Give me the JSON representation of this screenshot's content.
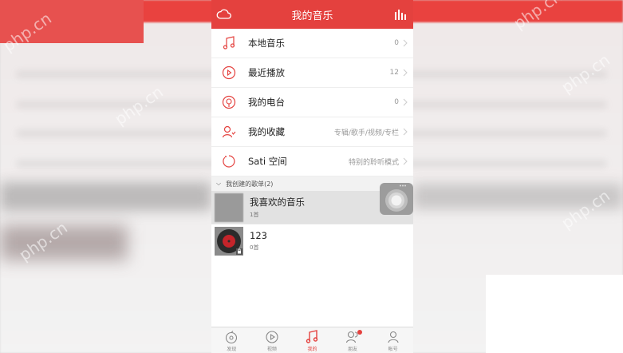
{
  "header": {
    "title": "我的音乐"
  },
  "menu": [
    {
      "label": "本地音乐",
      "right": "0",
      "icon": "music-note-icon"
    },
    {
      "label": "最近播放",
      "right": "12",
      "icon": "recent-play-icon"
    },
    {
      "label": "我的电台",
      "right": "0",
      "icon": "radio-icon"
    },
    {
      "label": "我的收藏",
      "right": "专辑/歌手/视频/专栏",
      "icon": "favorite-user-icon"
    },
    {
      "label": "Sati 空间",
      "right": "特别的聆听模式",
      "icon": "sati-icon"
    }
  ],
  "section": {
    "title": "我创建的歌单(2)"
  },
  "playlists": [
    {
      "name": "我喜欢的音乐",
      "count": "1首"
    },
    {
      "name": "123",
      "count": "0首"
    }
  ],
  "tabs": [
    {
      "label": "发现",
      "icon": "discover-icon"
    },
    {
      "label": "视频",
      "icon": "video-icon"
    },
    {
      "label": "我的",
      "icon": "my-music-icon"
    },
    {
      "label": "朋友",
      "icon": "friends-icon"
    },
    {
      "label": "帐号",
      "icon": "account-icon"
    }
  ],
  "watermark": "php.cn",
  "colors": {
    "accent": "#e4413e",
    "tab_active": "#e4413e"
  }
}
